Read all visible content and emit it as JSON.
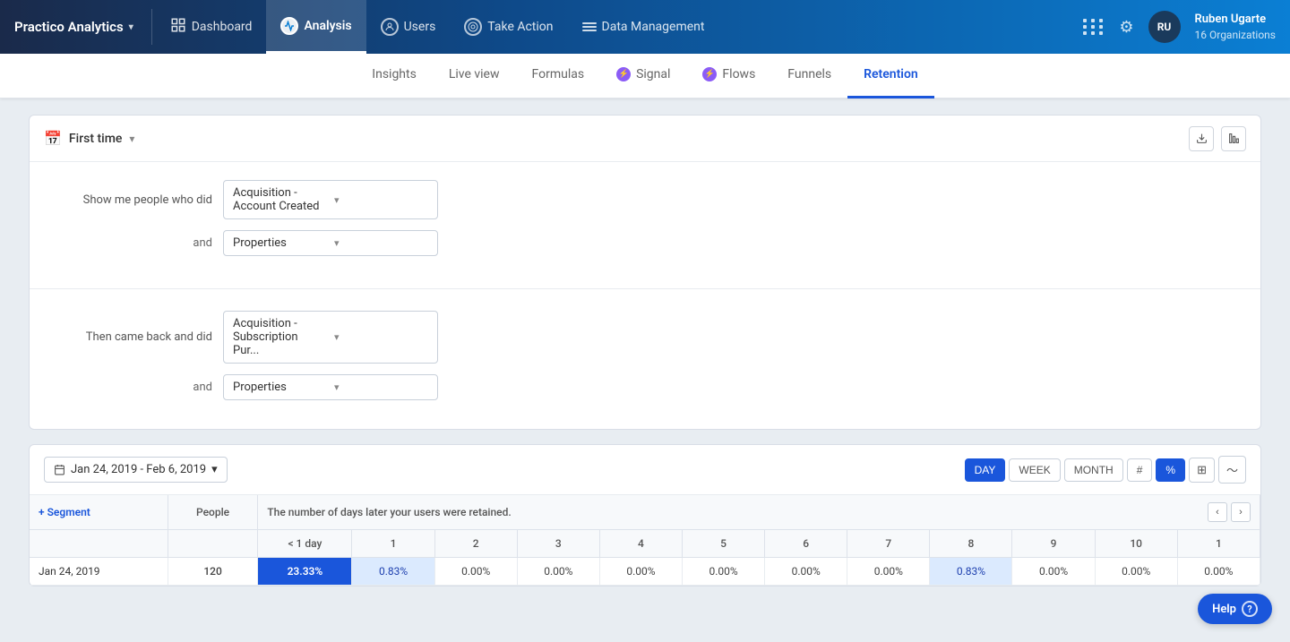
{
  "brand": {
    "name": "Practico Analytics",
    "arrow": "▾"
  },
  "nav": {
    "items": [
      {
        "id": "dashboard",
        "label": "Dashboard",
        "icon": "dashboard"
      },
      {
        "id": "analysis",
        "label": "Analysis",
        "icon": "pulse",
        "active": true
      },
      {
        "id": "users",
        "label": "Users",
        "icon": "user-circle"
      },
      {
        "id": "take-action",
        "label": "Take Action",
        "icon": "target-circle"
      },
      {
        "id": "data-management",
        "label": "Data Management",
        "icon": "layers"
      }
    ],
    "user": {
      "name": "Ruben Ugarte",
      "orgs": "16 Organizations",
      "initials": "RU"
    }
  },
  "sub_nav": {
    "items": [
      {
        "id": "insights",
        "label": "Insights"
      },
      {
        "id": "live-view",
        "label": "Live view"
      },
      {
        "id": "formulas",
        "label": "Formulas"
      },
      {
        "id": "signal",
        "label": "Signal",
        "icon": "purple"
      },
      {
        "id": "flows",
        "label": "Flows",
        "icon": "purple"
      },
      {
        "id": "funnels",
        "label": "Funnels"
      },
      {
        "id": "retention",
        "label": "Retention",
        "active": true
      }
    ]
  },
  "filter_card": {
    "first_time_label": "First time",
    "show_label": "Show me people who did",
    "acquisition_event": "Acquisition - Account Created",
    "properties_label": "Properties",
    "and_label": "and",
    "then_label": "Then came back and did",
    "subscription_event": "Acquisition - Subscription Pur...",
    "properties2_label": "Properties"
  },
  "retention_card": {
    "date_range": "Jan 24, 2019 - Feb 6, 2019",
    "view_options": [
      "DAY",
      "WEEK",
      "MONTH"
    ],
    "active_view": "DAY",
    "format_options": [
      "#",
      "%"
    ],
    "table_desc": "The number of days later your users were retained.",
    "segment_label": "+ Segment",
    "columns": [
      "< 1 day",
      "1",
      "2",
      "3",
      "4",
      "5",
      "6",
      "7",
      "8",
      "9",
      "10",
      "1"
    ],
    "rows": [
      {
        "segment": "Jan 24, 2019",
        "people": "120",
        "values": [
          "23.33%",
          "0.83%",
          "0.00%",
          "0.00%",
          "0.00%",
          "0.00%",
          "0.00%",
          "0.00%",
          "0.83%",
          "0.00%",
          "0.00%",
          "0.00%"
        ],
        "highlight": 0
      }
    ]
  },
  "help": {
    "label": "Help",
    "icon": "?"
  }
}
